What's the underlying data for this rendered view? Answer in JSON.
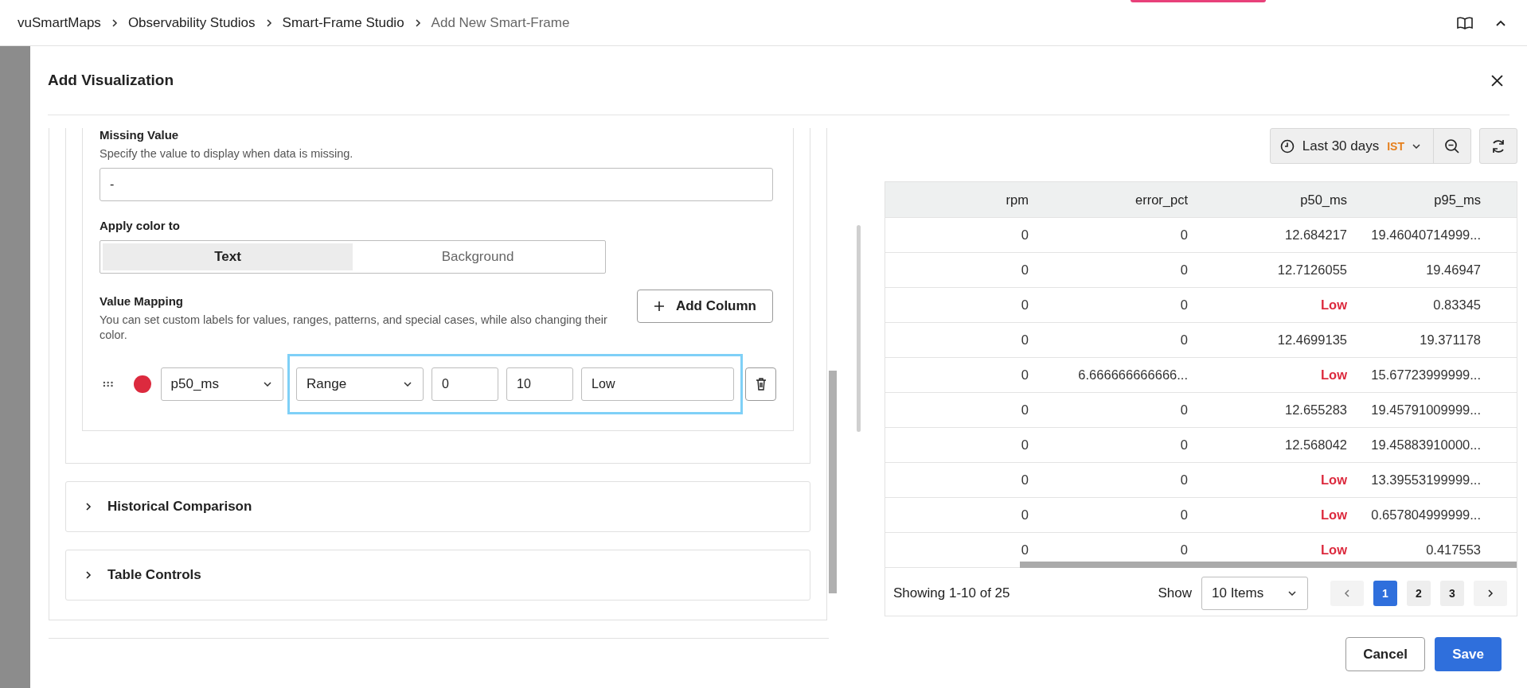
{
  "breadcrumb": [
    {
      "label": "vuSmartMaps",
      "current": false
    },
    {
      "label": "Observability Studios",
      "current": false
    },
    {
      "label": "Smart-Frame Studio",
      "current": false
    },
    {
      "label": "Add New Smart-Frame",
      "current": true
    }
  ],
  "modal": {
    "title": "Add Visualization"
  },
  "missing_value": {
    "label": "Missing Value",
    "description": "Specify the value to display when data is missing.",
    "value": "-"
  },
  "apply_color": {
    "label": "Apply color to",
    "options": [
      {
        "label": "Text",
        "selected": true
      },
      {
        "label": "Background",
        "selected": false
      }
    ]
  },
  "value_mapping": {
    "label": "Value Mapping",
    "description": "You can set custom labels for values, ranges, patterns, and special cases, while also changing their color.",
    "add_button": "Add Column",
    "rules": [
      {
        "color": "#dc2a3e",
        "column": "p50_ms",
        "type": "Range",
        "from": "0",
        "to": "10",
        "label": "Low"
      }
    ]
  },
  "sections": [
    {
      "title": "Historical Comparison",
      "expanded": false
    },
    {
      "title": "Table Controls",
      "expanded": false
    }
  ],
  "time_range": {
    "label": "Last 30 days",
    "timezone": "IST"
  },
  "table": {
    "columns": [
      "rpm",
      "error_pct",
      "p50_ms",
      "p95_ms"
    ],
    "rows": [
      [
        {
          "text": "0",
          "mapped": false
        },
        {
          "text": "0",
          "mapped": false
        },
        {
          "text": "12.684217",
          "mapped": false
        },
        {
          "text": "19.46040714999...",
          "mapped": false
        }
      ],
      [
        {
          "text": "0",
          "mapped": false
        },
        {
          "text": "0",
          "mapped": false
        },
        {
          "text": "12.7126055",
          "mapped": false
        },
        {
          "text": "19.46947",
          "mapped": false
        }
      ],
      [
        {
          "text": "0",
          "mapped": false
        },
        {
          "text": "0",
          "mapped": false
        },
        {
          "text": "Low",
          "mapped": true
        },
        {
          "text": "0.83345",
          "mapped": false
        }
      ],
      [
        {
          "text": "0",
          "mapped": false
        },
        {
          "text": "0",
          "mapped": false
        },
        {
          "text": "12.4699135",
          "mapped": false
        },
        {
          "text": "19.371178",
          "mapped": false
        }
      ],
      [
        {
          "text": "0",
          "mapped": false
        },
        {
          "text": "6.666666666666...",
          "mapped": false
        },
        {
          "text": "Low",
          "mapped": true
        },
        {
          "text": "15.67723999999...",
          "mapped": false
        }
      ],
      [
        {
          "text": "0",
          "mapped": false
        },
        {
          "text": "0",
          "mapped": false
        },
        {
          "text": "12.655283",
          "mapped": false
        },
        {
          "text": "19.45791009999...",
          "mapped": false
        }
      ],
      [
        {
          "text": "0",
          "mapped": false
        },
        {
          "text": "0",
          "mapped": false
        },
        {
          "text": "12.568042",
          "mapped": false
        },
        {
          "text": "19.45883910000...",
          "mapped": false
        }
      ],
      [
        {
          "text": "0",
          "mapped": false
        },
        {
          "text": "0",
          "mapped": false
        },
        {
          "text": "Low",
          "mapped": true
        },
        {
          "text": "13.39553199999...",
          "mapped": false
        }
      ],
      [
        {
          "text": "0",
          "mapped": false
        },
        {
          "text": "0",
          "mapped": false
        },
        {
          "text": "Low",
          "mapped": true
        },
        {
          "text": "0.657804999999...",
          "mapped": false
        }
      ],
      [
        {
          "text": "0",
          "mapped": false
        },
        {
          "text": "0",
          "mapped": false
        },
        {
          "text": "Low",
          "mapped": true
        },
        {
          "text": "0.417553",
          "mapped": false
        }
      ]
    ]
  },
  "pagination": {
    "summary": "Showing 1-10 of 25",
    "show_label": "Show",
    "page_size": "10 Items",
    "pages": [
      {
        "label": "1",
        "selected": true
      },
      {
        "label": "2",
        "selected": false
      },
      {
        "label": "3",
        "selected": false
      }
    ]
  },
  "footer": {
    "cancel": "Cancel",
    "save": "Save"
  }
}
